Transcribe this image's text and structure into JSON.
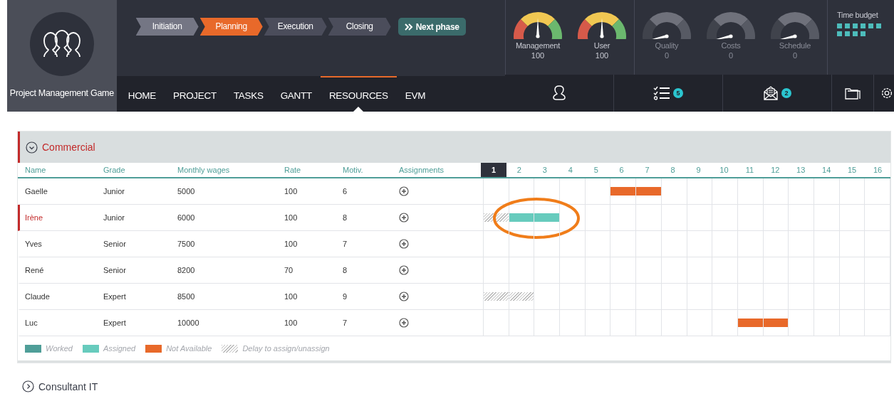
{
  "app": {
    "title": "Project Management Game"
  },
  "phases": [
    {
      "label": "Initiation",
      "completed": true,
      "selected": false
    },
    {
      "label": "Planning",
      "completed": false,
      "selected": true
    },
    {
      "label": "Execution",
      "completed": false,
      "selected": false
    },
    {
      "label": "Closing",
      "completed": false,
      "selected": false
    }
  ],
  "next_phase_button": {
    "label": "Next phase"
  },
  "nav": [
    {
      "label": "HOME",
      "selected": false
    },
    {
      "label": "PROJECT",
      "selected": false
    },
    {
      "label": "TASKS",
      "selected": false
    },
    {
      "label": "GANTT",
      "selected": false
    },
    {
      "label": "RESOURCES",
      "selected": true
    },
    {
      "label": "EVM",
      "selected": false
    }
  ],
  "gauges": [
    {
      "label": "Management",
      "value": "100",
      "enabled": true
    },
    {
      "label": "User",
      "value": "100",
      "enabled": true
    },
    {
      "label": "Quality",
      "value": "0",
      "enabled": false
    },
    {
      "label": "Costs",
      "value": "0",
      "enabled": false
    },
    {
      "label": "Schedule",
      "value": "0",
      "enabled": false
    }
  ],
  "time_budget": {
    "label": "Time budget",
    "blocks": [
      {
        "filled": true
      },
      {
        "filled": true
      },
      {
        "filled": true
      },
      {
        "filled": true
      },
      {
        "filled": true
      },
      {
        "filled": true
      },
      {
        "filled": true
      },
      {
        "filled": true
      },
      {
        "filled": true
      },
      {
        "filled": true
      }
    ]
  },
  "toolbar": [
    {
      "kind": "person"
    },
    {
      "kind": "tasks",
      "badge": "5"
    },
    {
      "kind": "mail",
      "badge": "2"
    },
    {
      "kind": "folder"
    },
    {
      "kind": "gear"
    }
  ],
  "sections": [
    {
      "title": "Commercial",
      "expanded": true,
      "columns": [
        "Name",
        "Grade",
        "Monthly wages",
        "Rate",
        "Motiv.",
        "Assignments"
      ],
      "weeks": [
        {
          "label": "1",
          "selected": true
        },
        {
          "label": "2",
          "selected": false
        },
        {
          "label": "3",
          "selected": false
        },
        {
          "label": "4",
          "selected": false
        },
        {
          "label": "5",
          "selected": false
        },
        {
          "label": "6",
          "selected": false
        },
        {
          "label": "7",
          "selected": false
        },
        {
          "label": "8",
          "selected": false
        },
        {
          "label": "9",
          "selected": false
        },
        {
          "label": "10",
          "selected": false
        },
        {
          "label": "11",
          "selected": false
        },
        {
          "label": "12",
          "selected": false
        },
        {
          "label": "13",
          "selected": false
        },
        {
          "label": "14",
          "selected": false
        },
        {
          "label": "15",
          "selected": false
        },
        {
          "label": "16",
          "selected": false
        }
      ],
      "rows": [
        {
          "name": "Gaelle",
          "grade": "Junior",
          "wages": "5000",
          "rate": "100",
          "motivation": "6",
          "selected": false,
          "circled": false,
          "cells": [
            {
              "kind": "none"
            },
            {
              "kind": "none"
            },
            {
              "kind": "none"
            },
            {
              "kind": "none"
            },
            {
              "kind": "none"
            },
            {
              "kind": "not_available"
            },
            {
              "kind": "not_available"
            },
            {
              "kind": "none"
            },
            {
              "kind": "none"
            },
            {
              "kind": "none"
            },
            {
              "kind": "none"
            },
            {
              "kind": "none"
            },
            {
              "kind": "none"
            },
            {
              "kind": "none"
            },
            {
              "kind": "none"
            },
            {
              "kind": "none"
            }
          ]
        },
        {
          "name": "Irène",
          "grade": "Junior",
          "wages": "6000",
          "rate": "100",
          "motivation": "8",
          "selected": true,
          "circled": true,
          "cells": [
            {
              "kind": "delay"
            },
            {
              "kind": "assigned"
            },
            {
              "kind": "assigned"
            },
            {
              "kind": "none"
            },
            {
              "kind": "none"
            },
            {
              "kind": "none"
            },
            {
              "kind": "none"
            },
            {
              "kind": "none"
            },
            {
              "kind": "none"
            },
            {
              "kind": "none"
            },
            {
              "kind": "none"
            },
            {
              "kind": "none"
            },
            {
              "kind": "none"
            },
            {
              "kind": "none"
            },
            {
              "kind": "none"
            },
            {
              "kind": "none"
            }
          ]
        },
        {
          "name": "Yves",
          "grade": "Senior",
          "wages": "7500",
          "rate": "100",
          "motivation": "7",
          "selected": false,
          "circled": false,
          "cells": [
            {
              "kind": "none"
            },
            {
              "kind": "none"
            },
            {
              "kind": "none"
            },
            {
              "kind": "none"
            },
            {
              "kind": "none"
            },
            {
              "kind": "none"
            },
            {
              "kind": "none"
            },
            {
              "kind": "none"
            },
            {
              "kind": "none"
            },
            {
              "kind": "none"
            },
            {
              "kind": "none"
            },
            {
              "kind": "none"
            },
            {
              "kind": "none"
            },
            {
              "kind": "none"
            },
            {
              "kind": "none"
            },
            {
              "kind": "none"
            }
          ]
        },
        {
          "name": "René",
          "grade": "Senior",
          "wages": "8200",
          "rate": "70",
          "motivation": "8",
          "selected": false,
          "circled": false,
          "cells": [
            {
              "kind": "none"
            },
            {
              "kind": "none"
            },
            {
              "kind": "none"
            },
            {
              "kind": "none"
            },
            {
              "kind": "none"
            },
            {
              "kind": "none"
            },
            {
              "kind": "none"
            },
            {
              "kind": "none"
            },
            {
              "kind": "none"
            },
            {
              "kind": "none"
            },
            {
              "kind": "none"
            },
            {
              "kind": "none"
            },
            {
              "kind": "none"
            },
            {
              "kind": "none"
            },
            {
              "kind": "none"
            },
            {
              "kind": "none"
            }
          ]
        },
        {
          "name": "Claude",
          "grade": "Expert",
          "wages": "8500",
          "rate": "100",
          "motivation": "9",
          "selected": false,
          "circled": false,
          "cells": [
            {
              "kind": "delay"
            },
            {
              "kind": "delay"
            },
            {
              "kind": "none"
            },
            {
              "kind": "none"
            },
            {
              "kind": "none"
            },
            {
              "kind": "none"
            },
            {
              "kind": "none"
            },
            {
              "kind": "none"
            },
            {
              "kind": "none"
            },
            {
              "kind": "none"
            },
            {
              "kind": "none"
            },
            {
              "kind": "none"
            },
            {
              "kind": "none"
            },
            {
              "kind": "none"
            },
            {
              "kind": "none"
            },
            {
              "kind": "none"
            }
          ]
        },
        {
          "name": "Luc",
          "grade": "Expert",
          "wages": "10000",
          "rate": "100",
          "motivation": "7",
          "selected": false,
          "circled": false,
          "cells": [
            {
              "kind": "none"
            },
            {
              "kind": "none"
            },
            {
              "kind": "none"
            },
            {
              "kind": "none"
            },
            {
              "kind": "none"
            },
            {
              "kind": "none"
            },
            {
              "kind": "none"
            },
            {
              "kind": "none"
            },
            {
              "kind": "none"
            },
            {
              "kind": "none"
            },
            {
              "kind": "not_available"
            },
            {
              "kind": "not_available"
            },
            {
              "kind": "none"
            },
            {
              "kind": "none"
            },
            {
              "kind": "none"
            },
            {
              "kind": "none"
            }
          ]
        }
      ],
      "legend": [
        {
          "kind": "worked",
          "label": "Worked"
        },
        {
          "kind": "assigned",
          "label": "Assigned"
        },
        {
          "kind": "not_available",
          "label": "Not Available"
        },
        {
          "kind": "delay",
          "label": "Delay to assign/unassign"
        }
      ]
    },
    {
      "title": "Consultant IT",
      "expanded": false
    }
  ]
}
